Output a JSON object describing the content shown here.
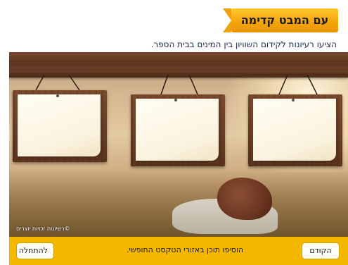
{
  "header": {
    "title": "עם המבט קדימה",
    "instruction": "הציעו רעיונות לקידום השוויון בין המינים בבית הספר."
  },
  "scene": {
    "credit": "©רשיונות זכויות יוצרים"
  },
  "boards": [
    {
      "text": ""
    },
    {
      "text": ""
    },
    {
      "text": ""
    }
  ],
  "footer": {
    "start_label": "להתחלה",
    "status_text": "הוסיפו תוכן באזורי הטקסט החופשי.",
    "prev_label": "הקודם"
  },
  "colors": {
    "banner": "#f6a70a",
    "footer": "#f6b700",
    "instruction_text": "#1d2a52"
  }
}
